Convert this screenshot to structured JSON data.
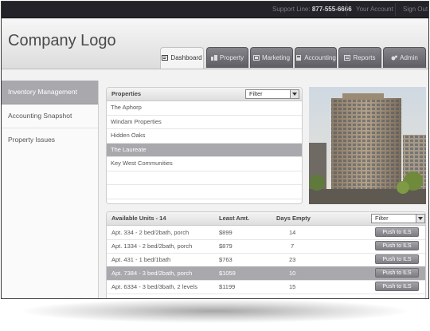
{
  "topbar": {
    "support_label": "Support Line:",
    "support_phone": "877-555-6666",
    "account": "Your Account",
    "signout": "Sign Out"
  },
  "header": {
    "logo": "Company Logo",
    "tabs": [
      {
        "label": "Dashboard",
        "icon": "dashboard-icon",
        "active": true
      },
      {
        "label": "Property",
        "icon": "property-icon",
        "active": false
      },
      {
        "label": "Marketing",
        "icon": "marketing-icon",
        "active": false
      },
      {
        "label": "Accounting",
        "icon": "accounting-icon",
        "active": false
      },
      {
        "label": "Reports",
        "icon": "reports-icon",
        "active": false
      },
      {
        "label": "Admin",
        "icon": "admin-icon",
        "active": false
      }
    ]
  },
  "sidebar": {
    "items": [
      {
        "label": "Inventory Management",
        "active": true
      },
      {
        "label": "Accounting Snapshot",
        "active": false
      },
      {
        "label": "Property Issues",
        "active": false
      }
    ]
  },
  "properties": {
    "title": "Properties",
    "filter": "Filter",
    "rows": [
      "The Aphorp",
      "Windam Properties",
      "Hidden Oaks",
      "The Laureate",
      "Key West Communities"
    ],
    "selected_index": 3
  },
  "units": {
    "headers": {
      "units": "Available Units - 14",
      "amount": "Least Amt.",
      "days": "Days Empty"
    },
    "filter": "Filter",
    "push_label": "Push to ILS",
    "rows": [
      {
        "unit": "Apt. 334 - 2 bed/2bath, porch",
        "amount": "$899",
        "days": "14"
      },
      {
        "unit": "Apt. 1334 - 2 bed/2bath, porch",
        "amount": "$879",
        "days": "7"
      },
      {
        "unit": "Apt. 431 - 1 bed/1bath",
        "amount": "$763",
        "days": "23"
      },
      {
        "unit": "Apt. 7384 - 3 bed/2bath, porch",
        "amount": "$1059",
        "days": "10"
      },
      {
        "unit": "Apt. 6334 - 3 bed/3bath, 2 levels",
        "amount": "$1199",
        "days": "15"
      }
    ],
    "selected_index": 3
  },
  "colors": {
    "topbar": "#232329",
    "tab": "#6e6e74",
    "selected_row": "#a9a9ad"
  }
}
